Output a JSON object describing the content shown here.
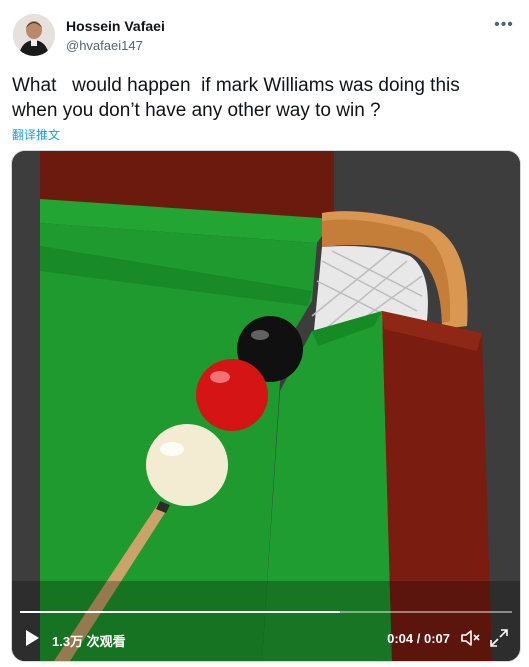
{
  "author": {
    "name": "Hossein Vafaei",
    "handle": "@hvafaei147"
  },
  "tweet": {
    "text": "What   would happen  if mark Williams was doing this\nwhen you don’t have any other way to win ?",
    "translate_label": "翻译推文"
  },
  "video": {
    "views_label": "1.3万 次观看",
    "time_label": "0:04 / 0:07",
    "progress": 0.65
  },
  "icons": {
    "more": "more-dots-icon",
    "play": "play-icon",
    "mute": "muted-speaker-icon",
    "fullscreen": "fullscreen-icon"
  },
  "colors": {
    "link": "#1d9bf0",
    "cloth": "#1e9b2e",
    "wood": "#6b1d10"
  }
}
